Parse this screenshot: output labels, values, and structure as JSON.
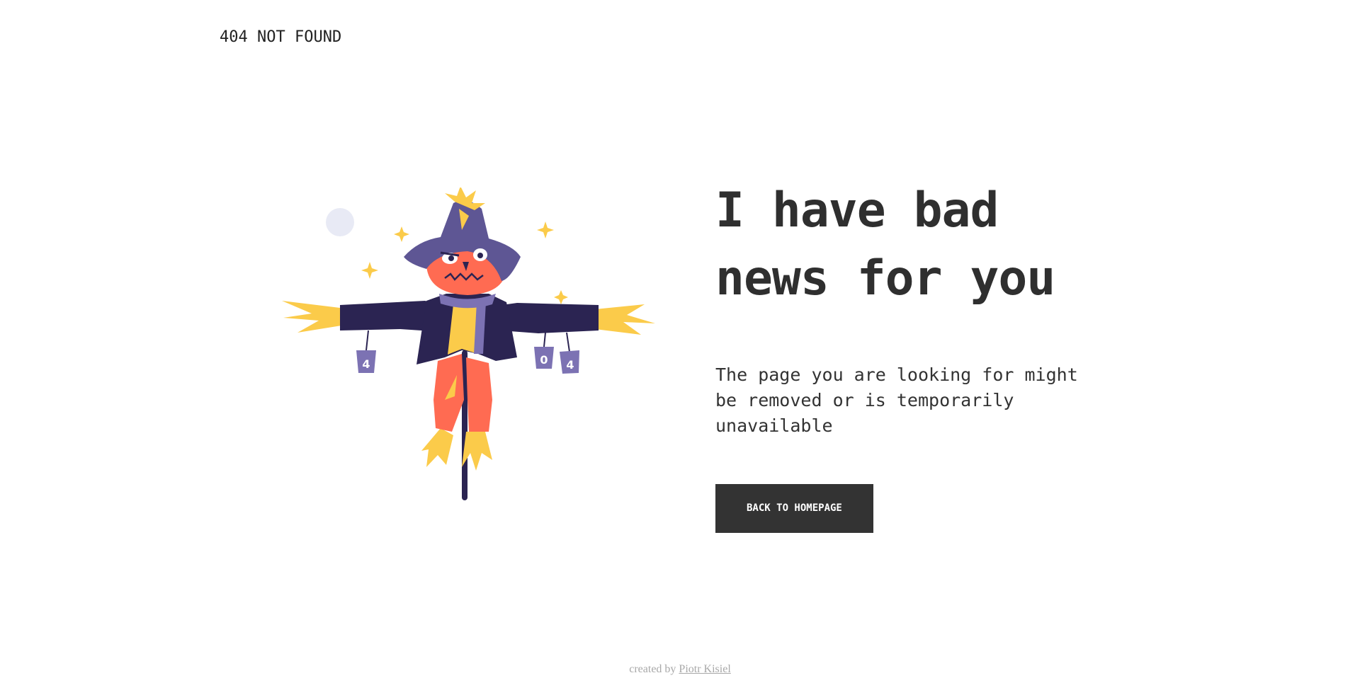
{
  "header": {
    "brand": "404 NOT FOUND"
  },
  "illustration": {
    "icon": "scarecrow-illustration",
    "cans": [
      "4",
      "0",
      "4"
    ],
    "colors": {
      "coat": "#2b2452",
      "hat": "#5e5694",
      "face": "#ff6b52",
      "straw": "#fbcb4a",
      "can": "#7c72b3",
      "moon": "#e8eaf5"
    }
  },
  "main": {
    "headline_line1": "I have bad",
    "headline_line2": "news for you",
    "description": "The page you are looking for might be removed or is temporarily unavailable",
    "button_label": "BACK TO HOMEPAGE"
  },
  "footer": {
    "prefix": "created by",
    "author": "Piotr Kisiel"
  }
}
